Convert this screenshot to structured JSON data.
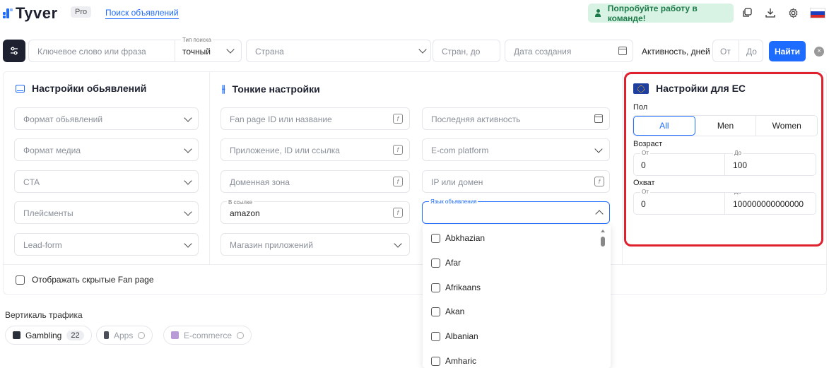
{
  "header": {
    "logo_text": "Tyver",
    "pro_badge": "Pro",
    "nav_link": "Поиск объявлений",
    "team_button": "Попробуйте работу в команде!",
    "colors": {
      "brand": "#1e6bff",
      "team_bg": "#d8f2e3",
      "team_text": "#1d7a4a"
    }
  },
  "search": {
    "keyword_placeholder": "Ключевое слово или фраза",
    "search_type_label": "Тип поиска",
    "search_type_value": "точный",
    "country_placeholder": "Страна",
    "countries_to_placeholder": "Стран, до",
    "created_placeholder": "Дата создания",
    "activity_label": "Активность, дней",
    "activity_from": "От",
    "activity_to": "До",
    "find_button": "Найти"
  },
  "ad_settings": {
    "title": "Настройки обьявлений",
    "fields": [
      "Формат обьявлений",
      "Формат медиа",
      "CTA",
      "Плейсменты",
      "Lead-form"
    ]
  },
  "fine_settings": {
    "title": "Тонкие настройки",
    "fanpage_placeholder": "Fan page ID или название",
    "app_placeholder": "Приложение, ID или ссылка",
    "domain_zone_placeholder": "Доменная зона",
    "in_link_label": "В ссылке",
    "in_link_value": "amazon",
    "app_store_placeholder": "Магазин приложений",
    "last_activity_placeholder": "Последняя активность",
    "ecom_placeholder": "E-com platform",
    "ip_domain_placeholder": "IP или домен",
    "language_label": "Язык объявления"
  },
  "language_options": [
    "Abkhazian",
    "Afar",
    "Afrikaans",
    "Akan",
    "Albanian",
    "Amharic"
  ],
  "eu_settings": {
    "title": "Настройки для ЕС",
    "gender_label": "Пол",
    "gender_options": [
      "All",
      "Men",
      "Women"
    ],
    "gender_selected": "All",
    "age_label": "Возраст",
    "age_from_label": "От",
    "age_from": "0",
    "age_to_label": "До",
    "age_to": "100",
    "reach_label": "Охват",
    "reach_from_label": "От",
    "reach_from": "0",
    "reach_to_label": "До",
    "reach_to": "100000000000000"
  },
  "hidden_fanpage_label": "Отображать скрытые Fan page",
  "traffic": {
    "title": "Вертикаль трафика",
    "chips": [
      {
        "label": "Gambling",
        "count": "22"
      },
      {
        "label": "Apps"
      },
      {
        "label": "E-commerce"
      }
    ]
  }
}
